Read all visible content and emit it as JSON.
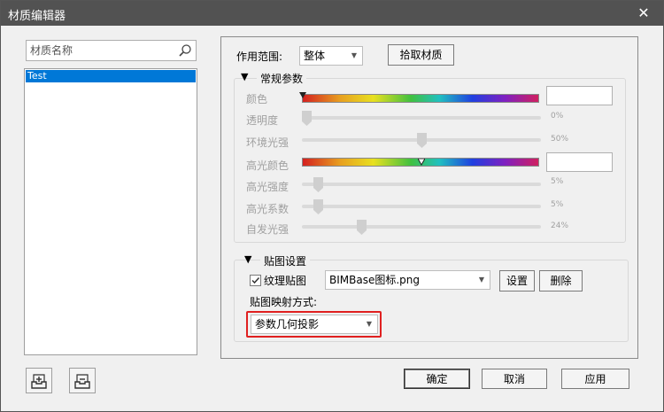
{
  "window": {
    "title": "材质编辑器",
    "close_icon": "close-icon"
  },
  "sidebar": {
    "search_placeholder": "材质名称",
    "materials": [
      {
        "name": "Test",
        "selected": true
      }
    ],
    "import_icon": "import-tray-icon",
    "export_icon": "export-tray-icon"
  },
  "scope": {
    "label": "作用范围:",
    "value": "整体",
    "pick_button": "拾取材质"
  },
  "general": {
    "header": "常规参数",
    "color": {
      "label": "颜色"
    },
    "transparency": {
      "label": "透明度",
      "value": "0%",
      "fraction": 0.0
    },
    "ambient": {
      "label": "环境光强",
      "value": "50%",
      "fraction": 0.5
    },
    "specular_color": {
      "label": "高光颜色"
    },
    "specular_strength": {
      "label": "高光强度",
      "value": "5%",
      "fraction": 0.05
    },
    "specular_coef": {
      "label": "高光系数",
      "value": "5%",
      "fraction": 0.05
    },
    "emissive": {
      "label": "自发光强",
      "value": "24%",
      "fraction": 0.24
    }
  },
  "texture": {
    "header": "贴图设置",
    "texture_checkbox_label": "纹理贴图",
    "texture_checked": true,
    "texture_file": "BIMBase图标.png",
    "settings_button": "设置",
    "delete_button": "删除",
    "mapping_label": "贴图映射方式:",
    "mapping_value": "参数几何投影",
    "highlight_color": "#e02020"
  },
  "footer": {
    "ok": "确定",
    "cancel": "取消",
    "apply": "应用"
  }
}
